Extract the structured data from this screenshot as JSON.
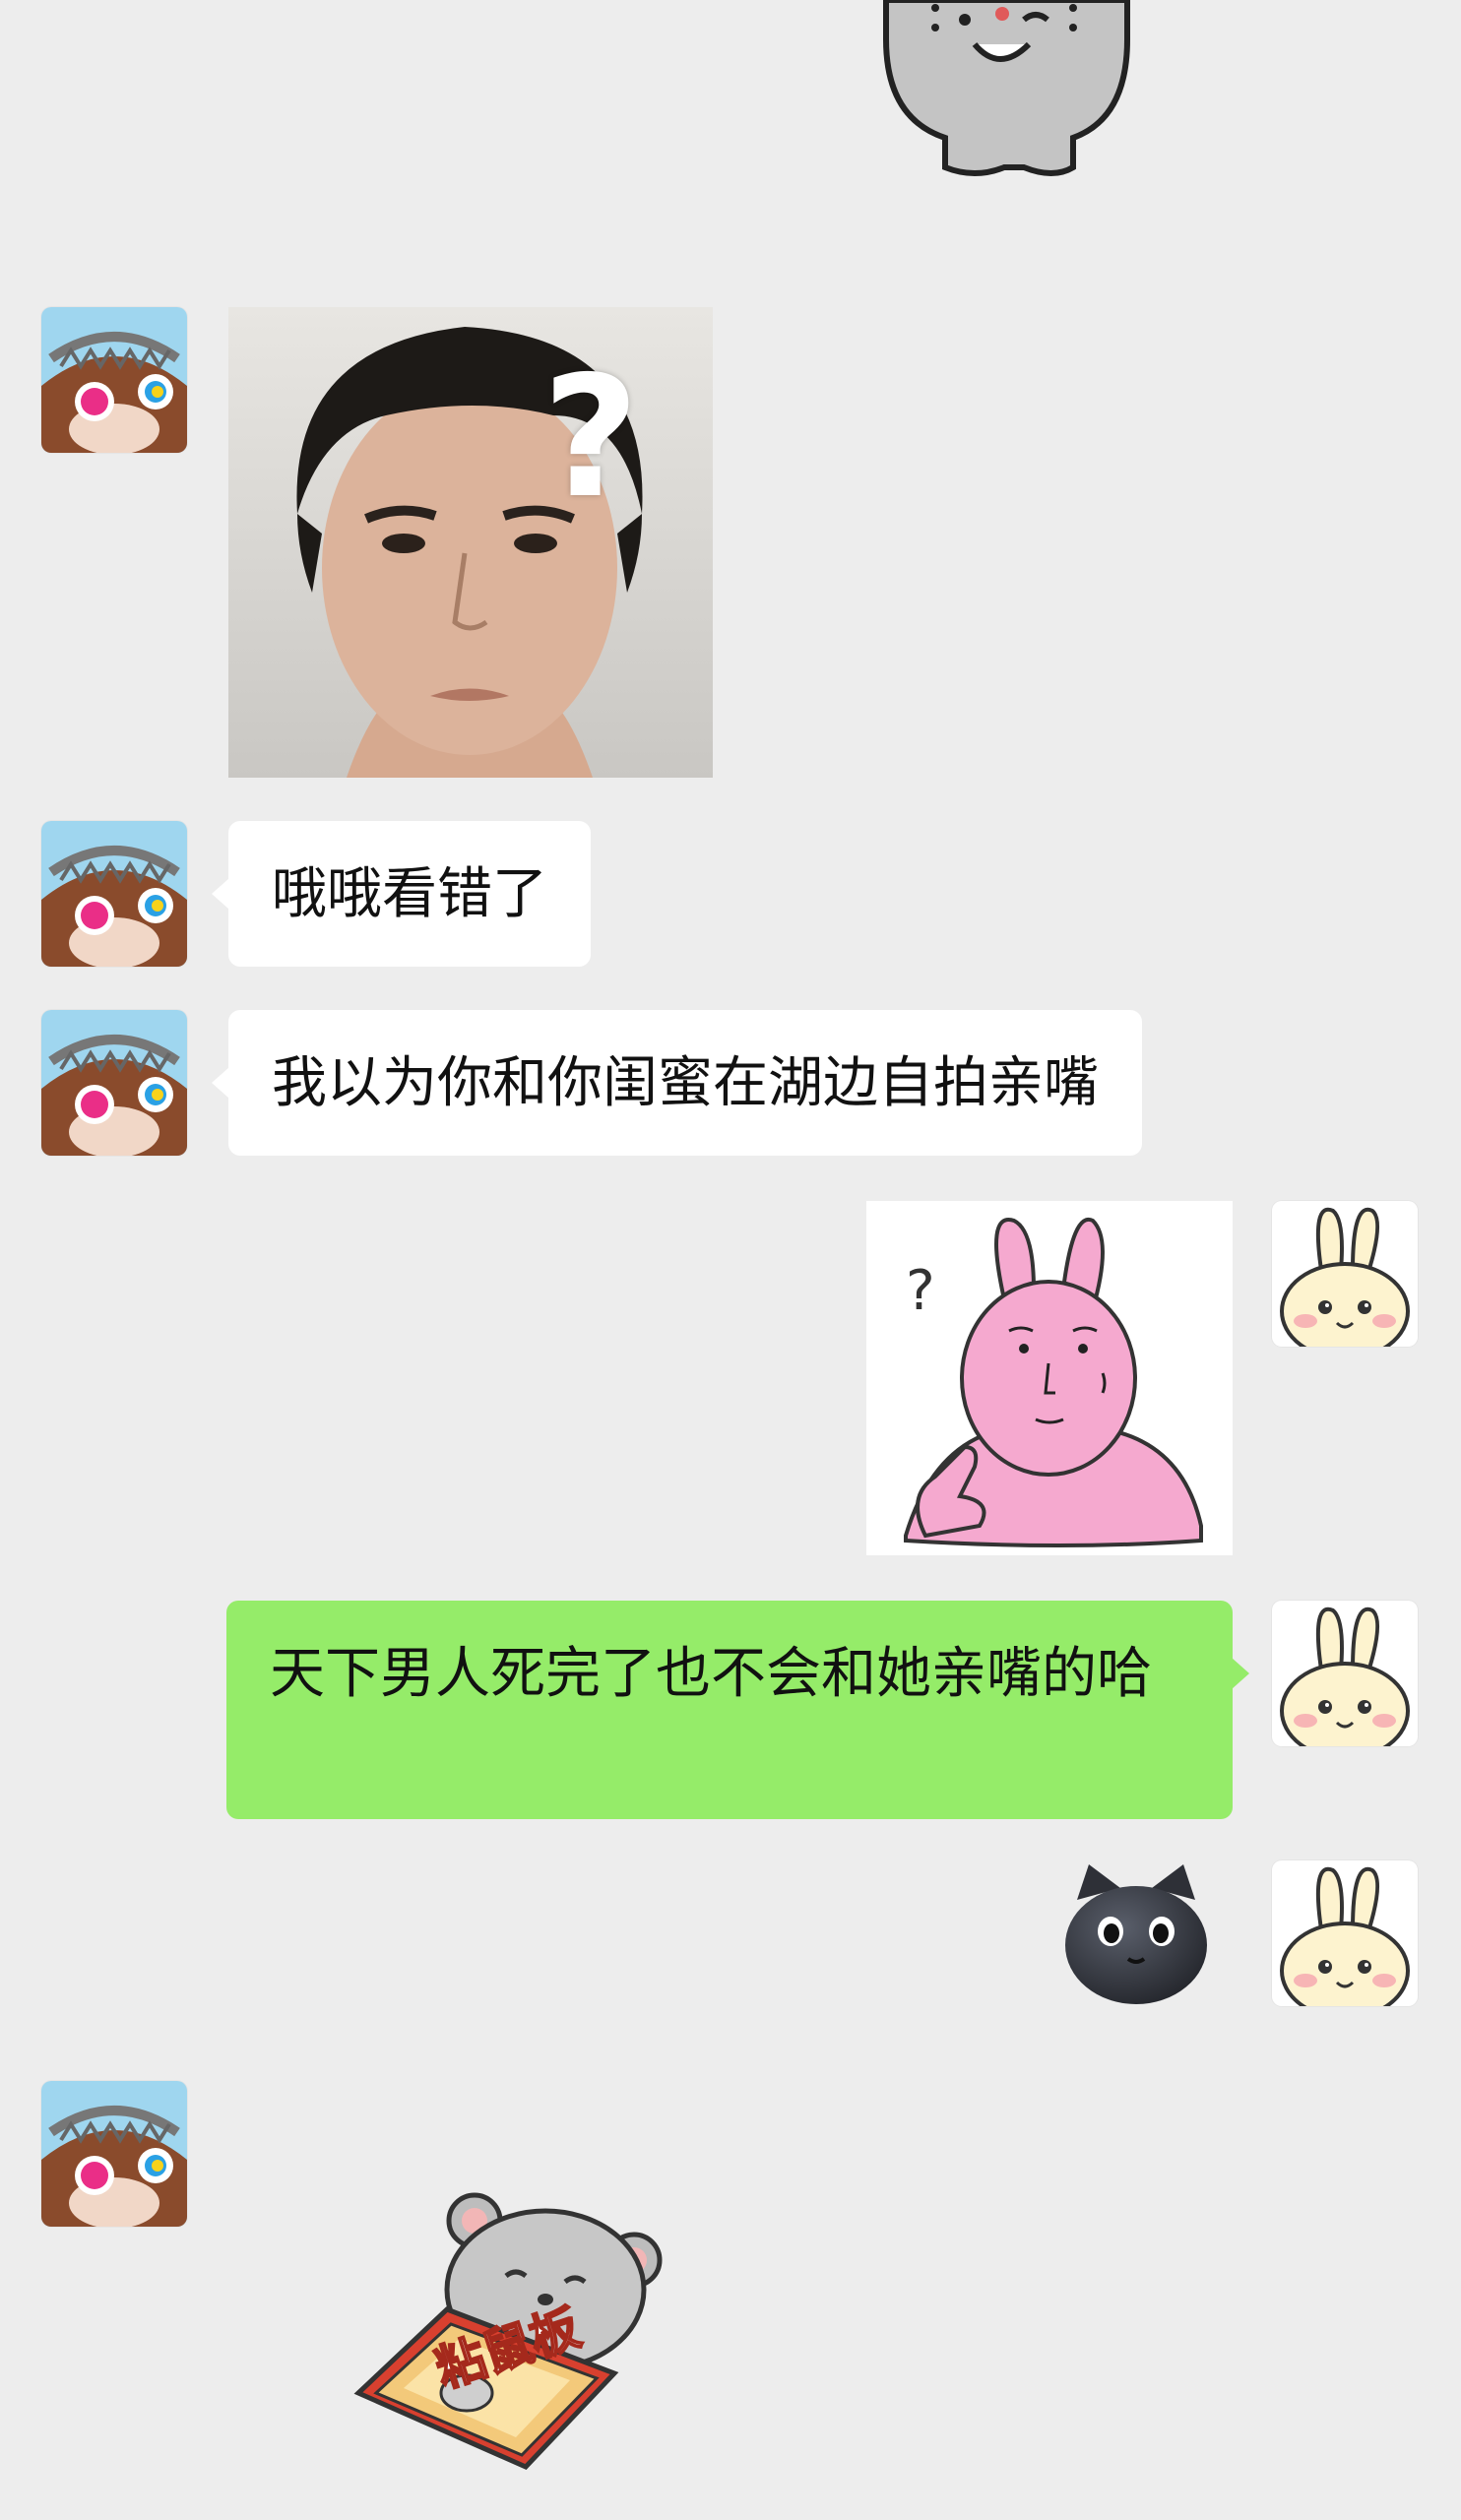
{
  "messages": [
    {
      "from": "other",
      "type": "image",
      "content": "photo-face-question"
    },
    {
      "from": "other",
      "type": "text",
      "text": "哦哦看错了"
    },
    {
      "from": "other",
      "type": "text",
      "text": "我以为你和你闺蜜在湖边自拍亲嘴"
    },
    {
      "from": "self",
      "type": "sticker",
      "content": "pink-rabbit-question"
    },
    {
      "from": "self",
      "type": "text",
      "text": "天下男人死完了也不会和她亲嘴的哈"
    },
    {
      "from": "self",
      "type": "sticker",
      "content": "black-cat-face"
    },
    {
      "from": "other",
      "type": "sticker",
      "content": "mouse-glue-board",
      "caption": "粘鼠板"
    }
  ],
  "image_overlay": {
    "symbol": "?"
  },
  "sticker_text": {
    "question": "?",
    "glue_board": "粘鼠板"
  },
  "colors": {
    "background": "#ededed",
    "incoming_bubble": "#ffffff",
    "outgoing_bubble": "#95ec69"
  },
  "icons": {
    "other_avatar": "brown-bear-avatar",
    "self_avatar": "cream-bunny-avatar"
  }
}
